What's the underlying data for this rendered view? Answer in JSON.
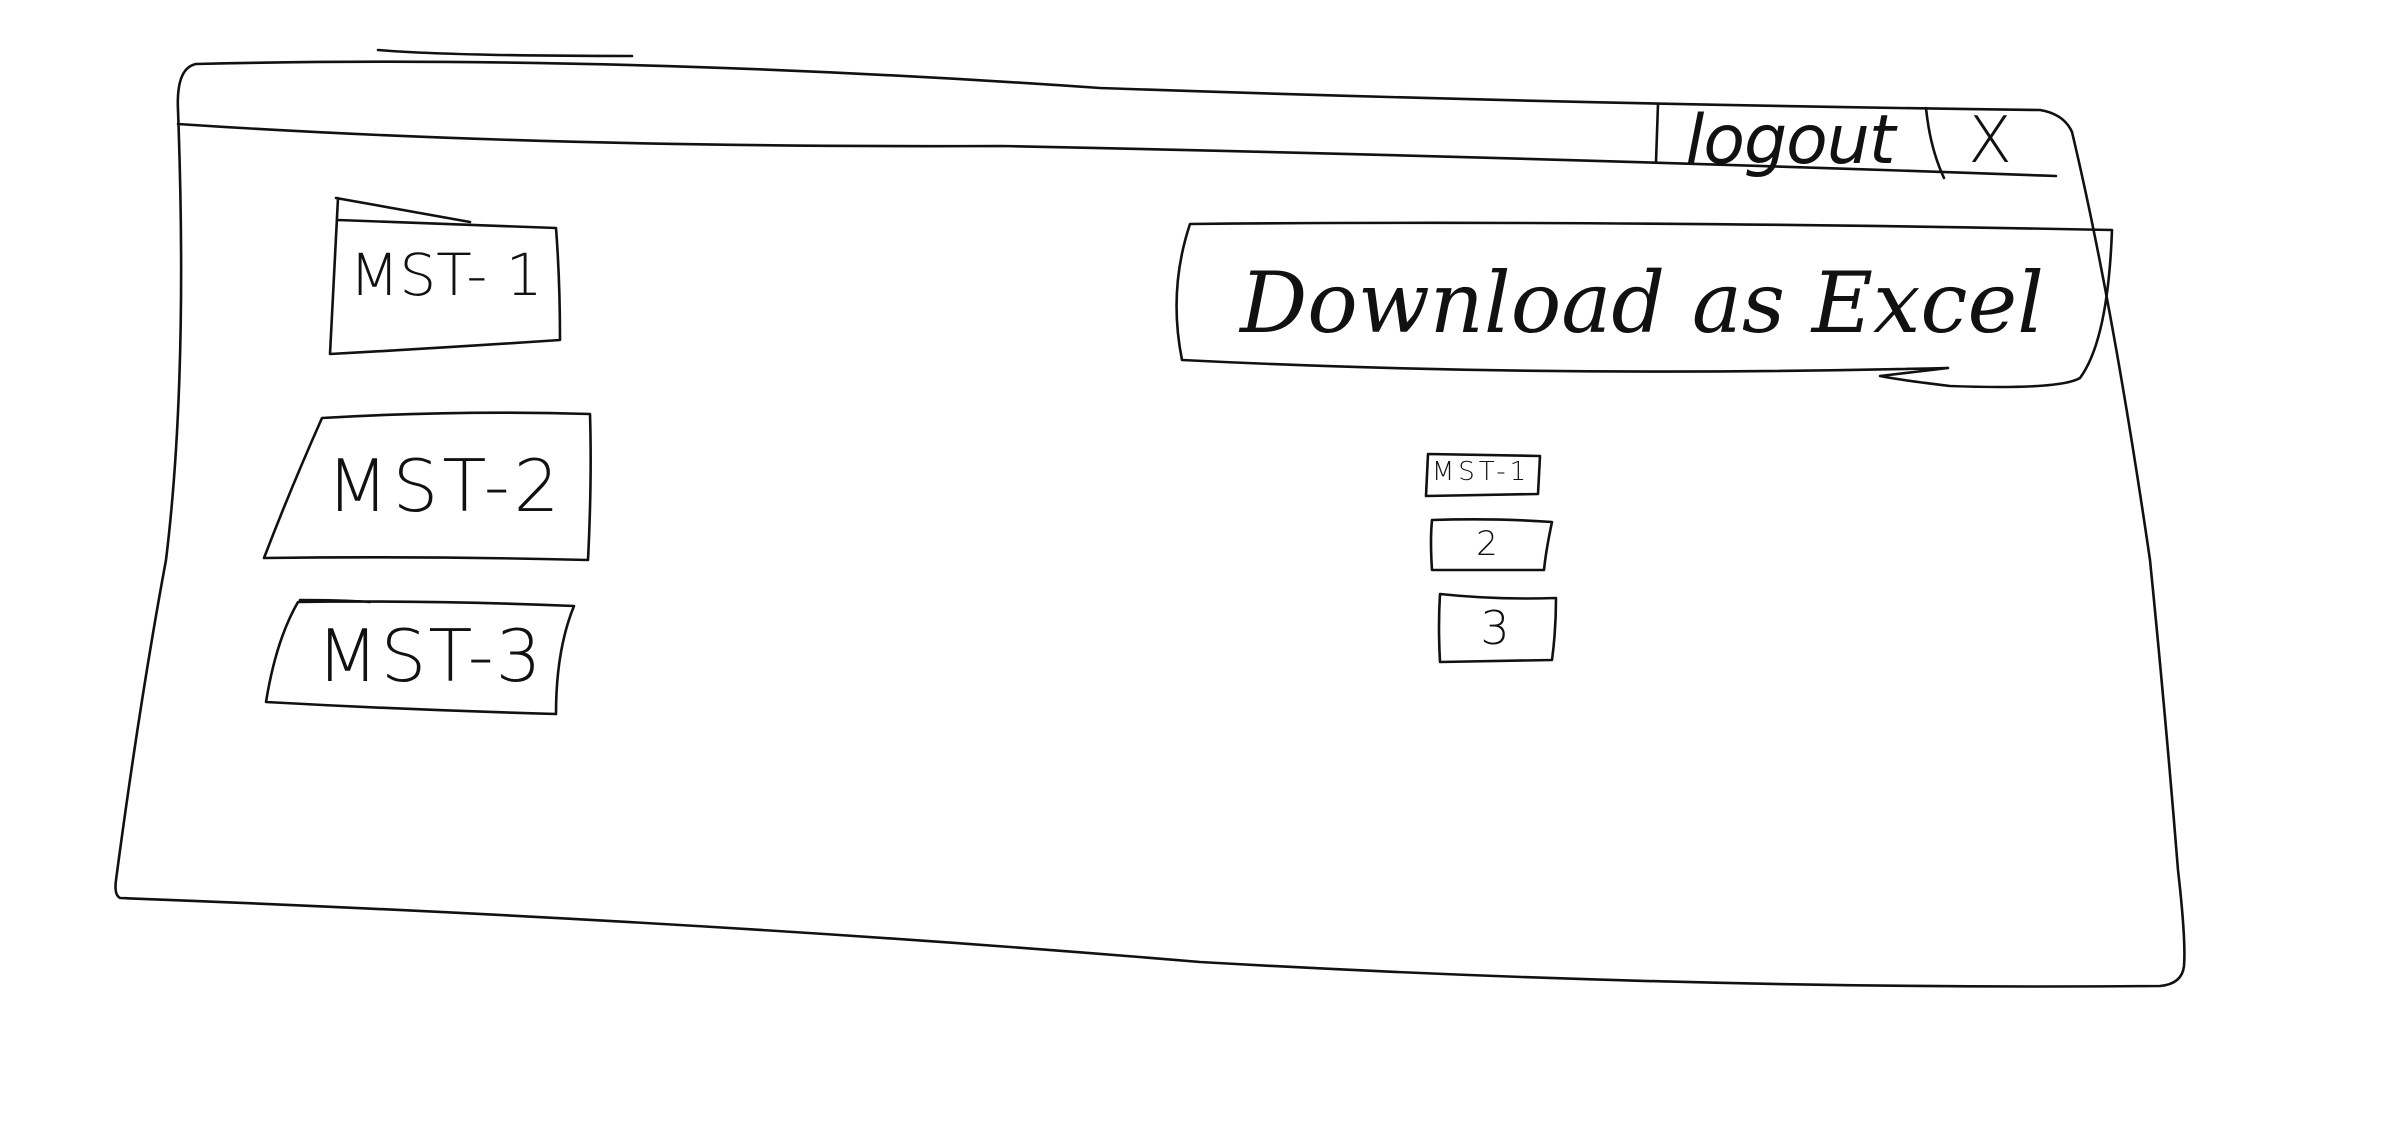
{
  "titlebar": {
    "logout_label": "logout",
    "close_label": "X"
  },
  "left_buttons": [
    {
      "label": "MST- 1"
    },
    {
      "label": "MST-2"
    },
    {
      "label": "MST-3"
    }
  ],
  "download": {
    "label": "Download as Excel"
  },
  "small_list": [
    {
      "label": "MST-1"
    },
    {
      "label": "2"
    },
    {
      "label": "3"
    }
  ],
  "style": {
    "ink_color": "#111111",
    "paper_color": "#ffffff"
  }
}
